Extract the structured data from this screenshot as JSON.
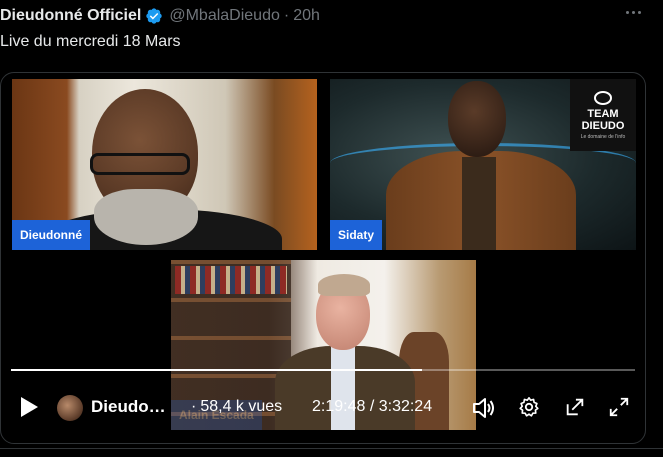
{
  "post": {
    "author_name": "Dieudonné Officiel",
    "handle": "@MbalaDieudo",
    "separator": "·",
    "time": "20h",
    "text": "Live du mercredi 18 Mars"
  },
  "video": {
    "participants": [
      {
        "label": "Dieudonné"
      },
      {
        "label": "Sidaty"
      },
      {
        "label": "Alain Escada"
      }
    ],
    "logo": {
      "line1": "TEAM",
      "line2": "DIEUDO",
      "line3": "Le domaine de l'info"
    },
    "progress_fraction": 0.658,
    "channel_name": "Dieudo…",
    "views_sep": "·",
    "views": "58,4 k vues",
    "timecode": "2:19:48 / 3:32:24"
  },
  "icons": {
    "verified": "verified-badge-icon",
    "more": "more-dots-icon",
    "play": "play-icon",
    "volume": "volume-icon",
    "settings": "gear-icon",
    "popout": "popout-icon",
    "fullscreen": "fullscreen-icon"
  },
  "colors": {
    "verified_blue": "#1d9bf0",
    "name_tag_blue": "#1d63d8",
    "muted_text": "#71767b"
  }
}
